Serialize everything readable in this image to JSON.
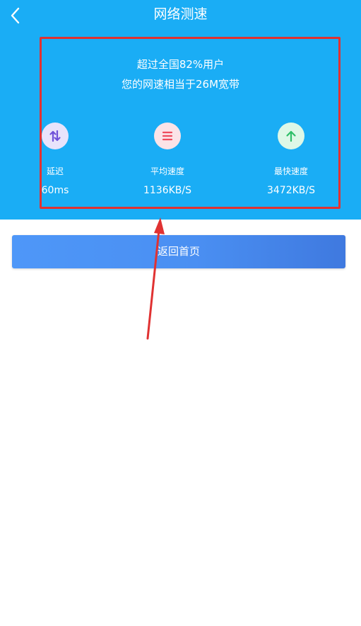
{
  "header": {
    "title": "网络测速"
  },
  "summary": {
    "line1": "超过全国82%用户",
    "line2": "您的网速相当于26M宽带"
  },
  "metrics": [
    {
      "label": "延迟",
      "value": "60ms",
      "icon": "latency-arrows-icon",
      "color": "#6f52d8"
    },
    {
      "label": "平均速度",
      "value": "1136KB/S",
      "icon": "menu-lines-icon",
      "color": "#ee4c5e"
    },
    {
      "label": "最快速度",
      "value": "3472KB/S",
      "icon": "arrow-up-icon",
      "color": "#2fbf68"
    }
  ],
  "actions": {
    "return_label": "返回首页"
  },
  "colors": {
    "header_bg": "#1aadf5",
    "highlight_border": "#e03232",
    "button_gradient_start": "#4e97f8",
    "button_gradient_end": "#3f79df"
  }
}
